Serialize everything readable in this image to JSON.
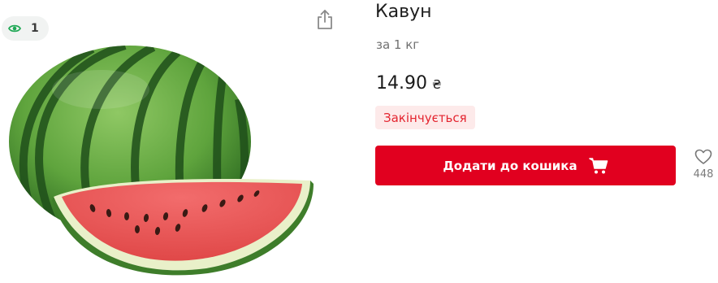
{
  "product": {
    "title": "Кавун",
    "unit": "за 1 кг",
    "price": "14.90",
    "currency": "₴",
    "stock_status": "Закінчується",
    "views": "1",
    "favorites": "448"
  },
  "actions": {
    "add_to_cart_label": "Додати до кошика"
  },
  "icons": {
    "views": "eye-icon",
    "share": "share-icon",
    "cart": "cart-icon",
    "favorite": "heart-icon"
  },
  "colors": {
    "accent": "#e1001f",
    "stock_badge_bg": "#fdeaea",
    "stock_badge_text": "#e4242f",
    "eye_icon": "#1fa855"
  }
}
